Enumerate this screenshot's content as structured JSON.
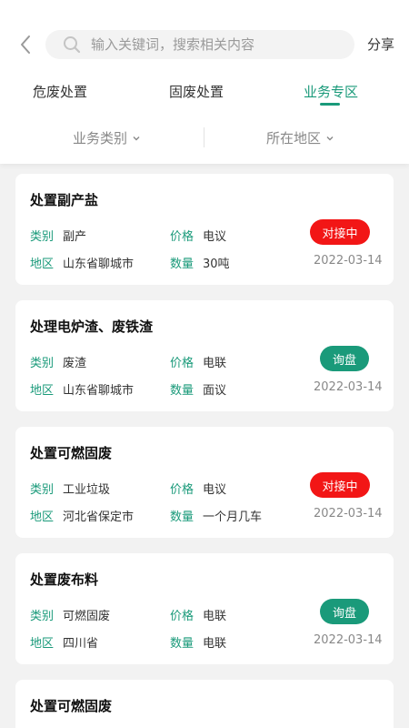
{
  "header": {
    "search_placeholder": "输入关键词，搜索相关内容",
    "share_label": "分享"
  },
  "tabs": [
    {
      "label": "危废处置",
      "active": false
    },
    {
      "label": "固废处置",
      "active": false
    },
    {
      "label": "业务专区",
      "active": true
    }
  ],
  "filters": {
    "category_label": "业务类别",
    "region_label": "所在地区"
  },
  "field_labels": {
    "category": "类别",
    "price": "价格",
    "region": "地区",
    "quantity": "数量"
  },
  "colors": {
    "accent": "#1a9a7a",
    "badge_red": "#f21616",
    "badge_green": "#1a9a7a"
  },
  "cards": [
    {
      "title": "处置副产盐",
      "category": "副产",
      "price": "电议",
      "region": "山东省聊城市",
      "quantity": "30吨",
      "date": "2022-03-14",
      "status": "对接中",
      "status_color": "red"
    },
    {
      "title": "处理电炉渣、废铁渣",
      "category": "废渣",
      "price": "电联",
      "region": "山东省聊城市",
      "quantity": "面议",
      "date": "2022-03-14",
      "status": "询盘",
      "status_color": "green"
    },
    {
      "title": "处置可燃固废",
      "category": "工业垃圾",
      "price": "电议",
      "region": "河北省保定市",
      "quantity": "一个月几车",
      "date": "2022-03-14",
      "status": "对接中",
      "status_color": "red"
    },
    {
      "title": "处置废布料",
      "category": "可燃固废",
      "price": "电联",
      "region": "四川省",
      "quantity": "电联",
      "date": "2022-03-14",
      "status": "询盘",
      "status_color": "green"
    },
    {
      "title": "处置可燃固废"
    }
  ]
}
